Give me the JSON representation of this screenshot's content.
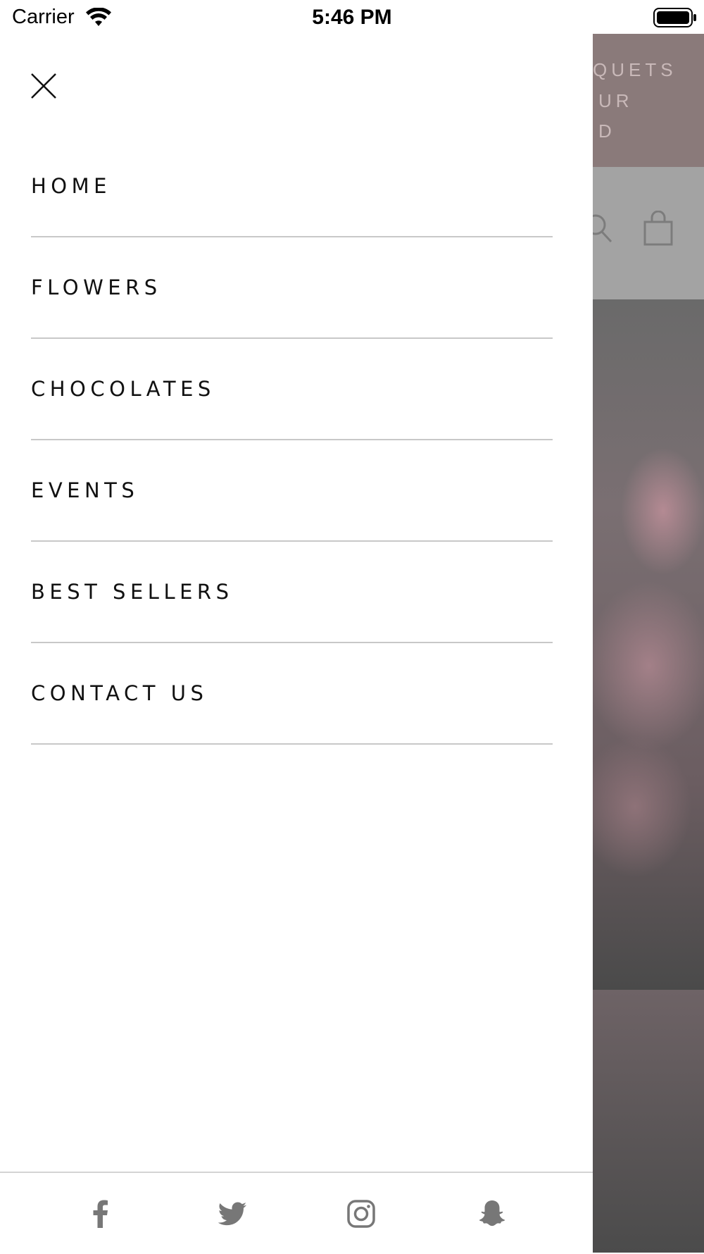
{
  "status_bar": {
    "carrier": "Carrier",
    "time": "5:46 PM",
    "icons": [
      "wifi-icon",
      "battery-icon"
    ]
  },
  "drawer": {
    "close_icon": "close-icon",
    "menu_items": [
      {
        "label": "HOME"
      },
      {
        "label": "FLOWERS"
      },
      {
        "label": "CHOCOLATES"
      },
      {
        "label": "EVENTS"
      },
      {
        "label": "BEST SELLERS"
      },
      {
        "label": "CONTACT US"
      }
    ],
    "social": [
      "facebook-icon",
      "twitter-icon",
      "instagram-icon",
      "snapchat-icon"
    ]
  },
  "background_page": {
    "banner_lines": [
      "QUETS",
      "UR",
      "D"
    ],
    "header_icons": [
      "search-icon",
      "shopping-bag-icon"
    ]
  },
  "colors": {
    "menu_text": "#111111",
    "divider": "#c8c8c8",
    "social_icon": "#777777",
    "overlay_banner": "#8a7a7a"
  }
}
